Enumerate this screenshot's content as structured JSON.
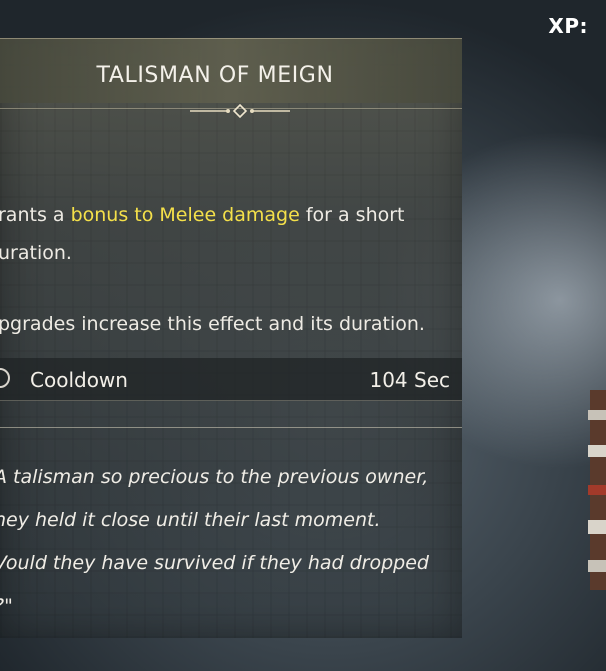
{
  "hud": {
    "xp_label": "XP:"
  },
  "talisman": {
    "name": "TALISMAN OF MEIGN",
    "description_prefix": "rants a ",
    "description_highlight": "bonus to Melee damage",
    "description_suffix_line1": " for a short",
    "description_line2": "uration.",
    "upgrade_text": "pgrades increase this effect and its duration.",
    "stat": {
      "label": "Cooldown",
      "value": "104 Sec"
    },
    "lore_lines": [
      "A talisman so precious to the previous owner,",
      "hey held it close until their last moment.",
      "Vould they have survived if they had dropped",
      "?\""
    ],
    "highlight_color": "#f4e04a"
  },
  "icons": [
    "ornament-icon",
    "cooldown-icon"
  ]
}
